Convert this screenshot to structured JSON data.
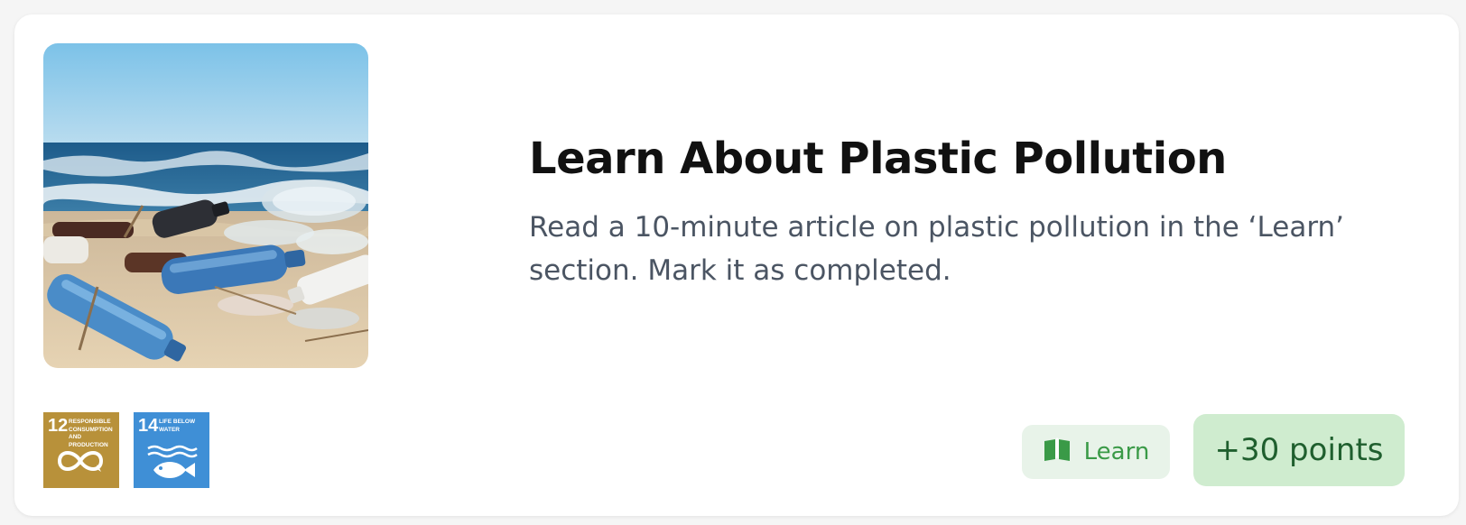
{
  "card": {
    "title": "Learn About Plastic Pollution",
    "description": "Read a 10-minute article on plastic pollution in the ‘Learn’ section. Mark it as completed.",
    "image_icon": "plastic-bottles-on-beach-photo"
  },
  "sdg_badges": [
    {
      "number": "12",
      "label": "Responsible consumption and production",
      "icon": "infinity-icon",
      "color": "#b8913a"
    },
    {
      "number": "14",
      "label": "Life below water",
      "icon": "fish-icon",
      "color": "#3f8fd6"
    }
  ],
  "actions": {
    "learn_label": "Learn",
    "learn_icon": "open-book-icon",
    "points_label": "+30 points"
  },
  "colors": {
    "learn_text": "#3a9a47",
    "learn_bg": "#e8f3e9",
    "points_text": "#1f5f2e",
    "points_bg": "#cfeccf"
  }
}
